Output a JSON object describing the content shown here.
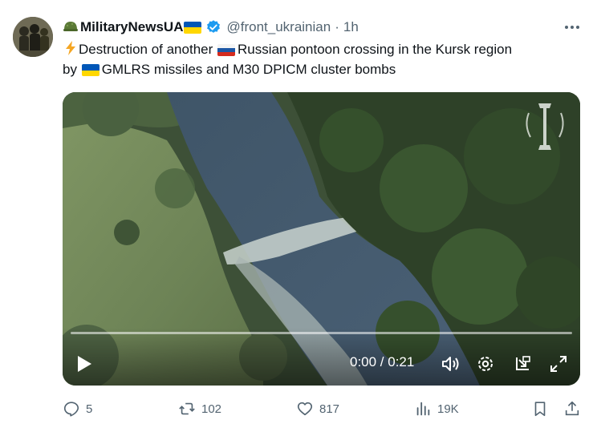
{
  "tweet": {
    "display_name": "MilitaryNewsUA",
    "handle": "@front_ukrainian",
    "separator": "·",
    "time": "1h",
    "text_part1": "Destruction of another ",
    "text_part2": "Russian pontoon crossing in the Kursk region",
    "text_part3": "by ",
    "text_part4": "GMLRS missiles and M30 DPICM cluster bombs"
  },
  "video": {
    "timecode": "0:00 / 0:21",
    "progress": 0,
    "icons": [
      "play-icon",
      "volume-icon",
      "settings-icon",
      "dock-icon",
      "fullscreen-icon"
    ]
  },
  "actions": {
    "replies": "5",
    "reposts": "102",
    "likes": "817",
    "views": "19K"
  },
  "colors": {
    "text": "#0f1419",
    "secondary": "#536471",
    "verified": "#1d9bf0"
  }
}
